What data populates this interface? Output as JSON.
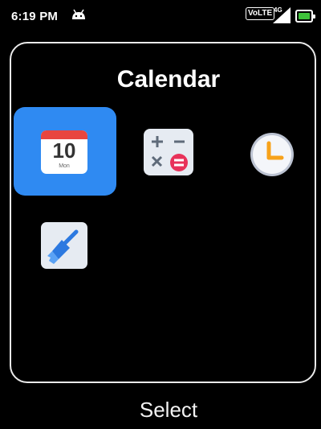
{
  "status_bar": {
    "time": "6:19 PM",
    "network_badge": "VoLTE",
    "network_type": "4G",
    "icons": [
      "android-icon",
      "signal-icon",
      "battery-icon"
    ],
    "battery_color": "#3ec23a"
  },
  "folder": {
    "title": "Calendar",
    "apps": [
      {
        "name": "Calendar",
        "icon": "calendar-icon",
        "date_number": "10",
        "date_label": "Mon",
        "selected": true
      },
      {
        "name": "Calculator",
        "icon": "calculator-icon",
        "selected": false
      },
      {
        "name": "Clock",
        "icon": "clock-icon",
        "selected": false
      },
      {
        "name": "Cleaner",
        "icon": "cleaner-broom-icon",
        "selected": false
      }
    ],
    "selection_color": "#2f8af2"
  },
  "softkey": {
    "center_label": "Select"
  }
}
